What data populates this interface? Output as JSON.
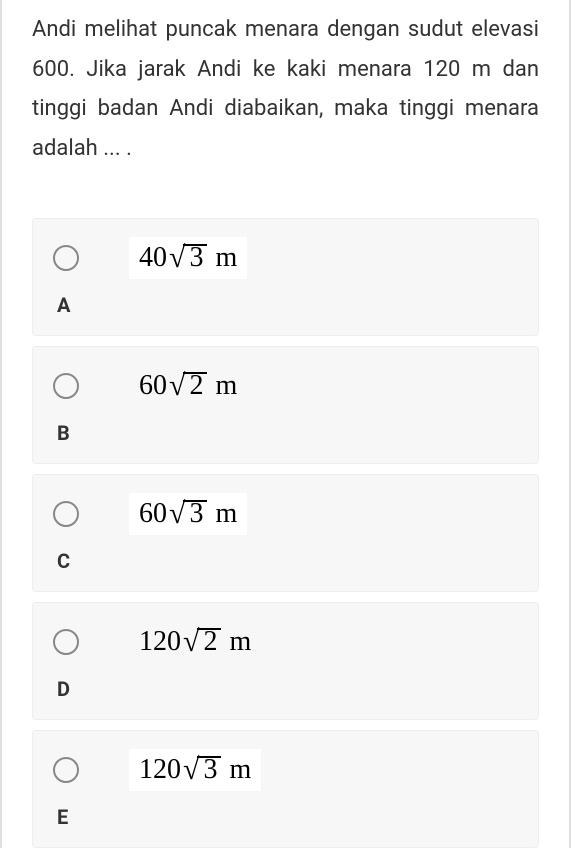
{
  "question": "Andi melihat puncak menara dengan sudut elevasi 600. Jika jarak Andi ke kaki menara 120 m dan tinggi badan Andi diabaikan, maka tinggi menara adalah ... .",
  "options": [
    {
      "letter": "A",
      "coefficient": "40",
      "radicand": "3",
      "unit": "m",
      "boxed": true
    },
    {
      "letter": "B",
      "coefficient": "60",
      "radicand": "2",
      "unit": "m",
      "boxed": false
    },
    {
      "letter": "C",
      "coefficient": "60",
      "radicand": "3",
      "unit": "m",
      "boxed": true
    },
    {
      "letter": "D",
      "coefficient": "120",
      "radicand": "2",
      "unit": "m",
      "boxed": false
    },
    {
      "letter": "E",
      "coefficient": "120",
      "radicand": "3",
      "unit": "m",
      "boxed": true
    }
  ]
}
